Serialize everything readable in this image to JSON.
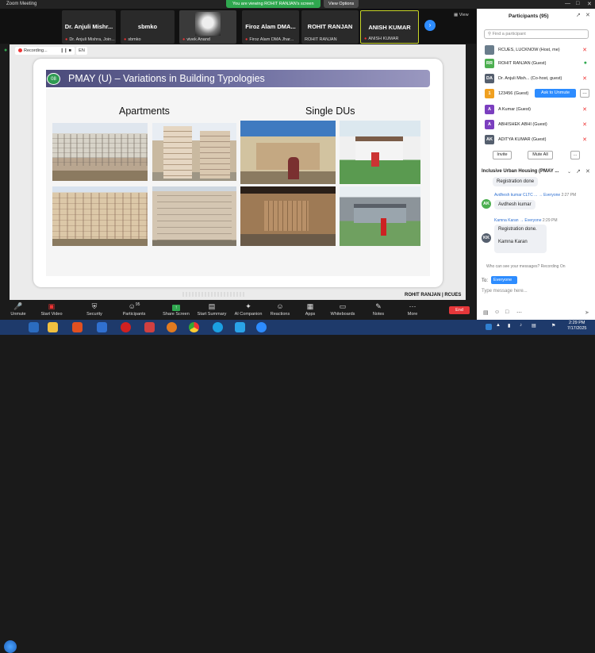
{
  "window": {
    "title": "Zoom Meeting"
  },
  "share_banner": {
    "text": "You are viewing ROHIT RANJAN's screen",
    "view_options": "View Options"
  },
  "gallery": {
    "tiles": [
      {
        "big": "Dr. Anjuli Mishr...",
        "small": "Dr. Anjuli Mishra, Join..."
      },
      {
        "big": "sbmko",
        "small": "sbmko"
      },
      {
        "big": "",
        "small": "vivek Anand"
      },
      {
        "big": "Firoz Alam DMA...",
        "small": "Firoz Alam DMA Jhar..."
      },
      {
        "big": "ROHIT RANJAN",
        "small": "ROHIT RANJAN"
      },
      {
        "big": "ANISH KUMAR",
        "small": "ANISH KUMAR"
      }
    ],
    "view_label": "View"
  },
  "recording": {
    "label": "Recording...",
    "lang": "EN"
  },
  "slide": {
    "number": "08",
    "title": "PMAY (U) – Variations in Building Typologies",
    "left_heading": "Apartments",
    "right_heading": "Single DUs",
    "footer": "ROHIT RANJAN | RCUES"
  },
  "participants": {
    "title": "Participants (95)",
    "search_placeholder": "Find a participant",
    "rows": [
      {
        "initials": "",
        "name": "RCUES, LUCKNOW (Host, me)",
        "color": "#6a7d8c"
      },
      {
        "initials": "RR",
        "name": "ROHIT RANJAN (Guest)",
        "color": "#4caf50"
      },
      {
        "initials": "DA",
        "name": "Dr. Anjuli Mish... (Co-host, guest)",
        "color": "#555f6e"
      },
      {
        "initials": "1",
        "name": "123456 (Guest)",
        "color": "#f0a020"
      },
      {
        "initials": "A",
        "name": "A Kumar (Guest)",
        "color": "#7b3fbf"
      },
      {
        "initials": "A",
        "name": "ABHISHEK ABHI (Guest)",
        "color": "#7b3fbf"
      },
      {
        "initials": "AK",
        "name": "ADITYA KUMAR (Guest)",
        "color": "#555f6e"
      }
    ],
    "ask_unmute": "Ask to Unmute",
    "invite": "Invite",
    "mute_all": "Mute All"
  },
  "chat": {
    "title": "Inclusive Urban Housing (PMAY ...",
    "messages": [
      {
        "text": "Registration done"
      },
      {
        "initials": "AK",
        "from": "Avdhesh kumar CLTC ...",
        "to": "Everyone",
        "time": "2:27 PM",
        "text": "Avdhesh kumar"
      },
      {
        "initials": "KK",
        "from": "Kamna Karan",
        "to": "Everyone",
        "time": "2:29 PM",
        "text_lines": [
          "Registration done.",
          "Kamna Karan"
        ]
      }
    ],
    "recv_note": "Who can see your messages? Recording On",
    "to_label": "To:",
    "to_value": "Everyone",
    "input_placeholder": "Type message here..."
  },
  "toolbar": {
    "items": [
      {
        "label": "Unmute",
        "icon": "mic-muted-icon"
      },
      {
        "label": "Start Video",
        "icon": "video-off-icon"
      },
      {
        "label": "Security",
        "icon": "shield-icon"
      },
      {
        "label": "Participants",
        "icon": "people-icon",
        "count": "95"
      },
      {
        "label": "Share Screen",
        "icon": "share-screen-icon"
      },
      {
        "label": "Start Summary",
        "icon": "summary-icon"
      },
      {
        "label": "AI Companion",
        "icon": "sparkle-icon"
      },
      {
        "label": "Reactions",
        "icon": "reactions-icon"
      },
      {
        "label": "Apps",
        "icon": "apps-icon"
      },
      {
        "label": "Whiteboards",
        "icon": "whiteboard-icon"
      },
      {
        "label": "Notes",
        "icon": "notes-icon"
      },
      {
        "label": "More",
        "icon": "more-icon"
      }
    ],
    "end": "End"
  },
  "taskbar": {
    "time": "2:29 PM",
    "date": "7/17/2025"
  }
}
